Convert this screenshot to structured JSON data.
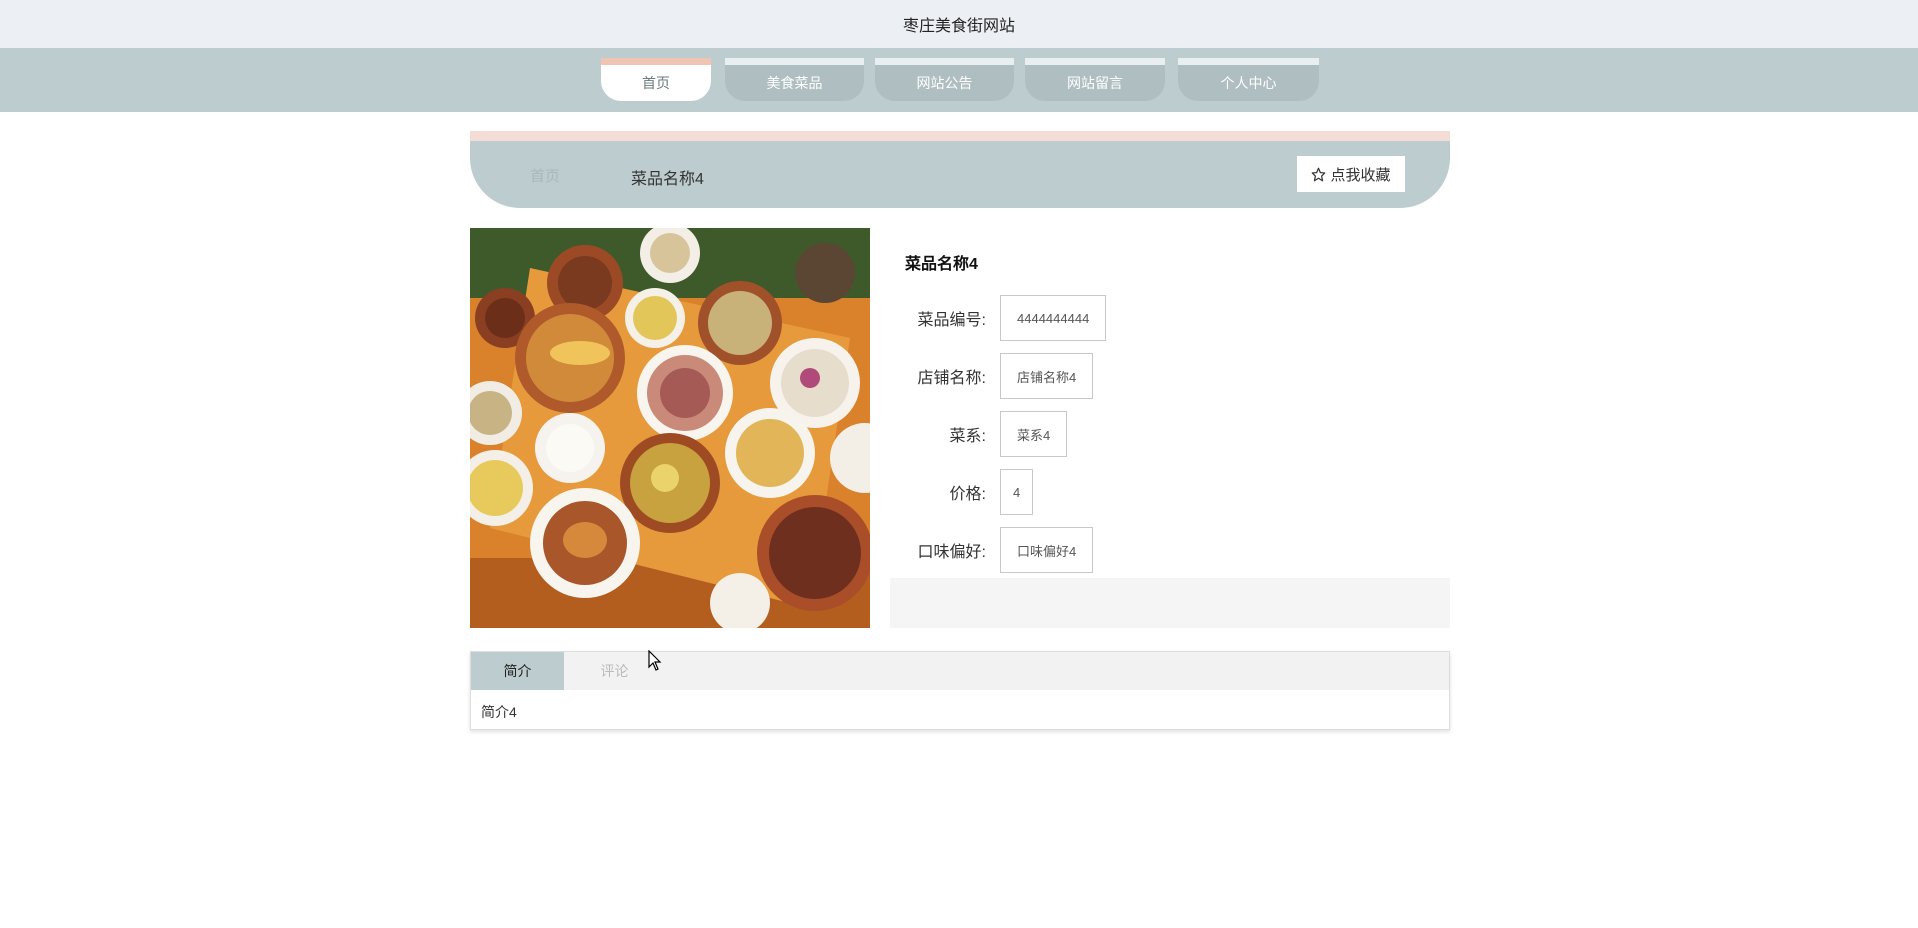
{
  "site": {
    "title": "枣庄美食街网站"
  },
  "nav": {
    "items": [
      {
        "label": "首页"
      },
      {
        "label": "美食菜品"
      },
      {
        "label": "网站公告"
      },
      {
        "label": "网站留言"
      },
      {
        "label": "个人中心"
      }
    ]
  },
  "breadcrumb": {
    "home": "首页",
    "current": "菜品名称4",
    "favorite_label": "点我收藏"
  },
  "image": {
    "icon": "food-photo"
  },
  "detail": {
    "title": "菜品名称4",
    "fields": [
      {
        "label": "菜品编号:",
        "value": "4444444444"
      },
      {
        "label": "店铺名称:",
        "value": "店铺名称4"
      },
      {
        "label": "菜系:",
        "value": "菜系4"
      },
      {
        "label": "价格:",
        "value": "4"
      },
      {
        "label": "口味偏好:",
        "value": "口味偏好4"
      }
    ]
  },
  "tabs": {
    "items": [
      {
        "label": "简介"
      },
      {
        "label": "评论"
      }
    ],
    "content": "简介4"
  },
  "colors": {
    "nav_bg": "#bdcccf",
    "header_bg": "#eceff3",
    "accent_top": "#f1c3b5"
  }
}
